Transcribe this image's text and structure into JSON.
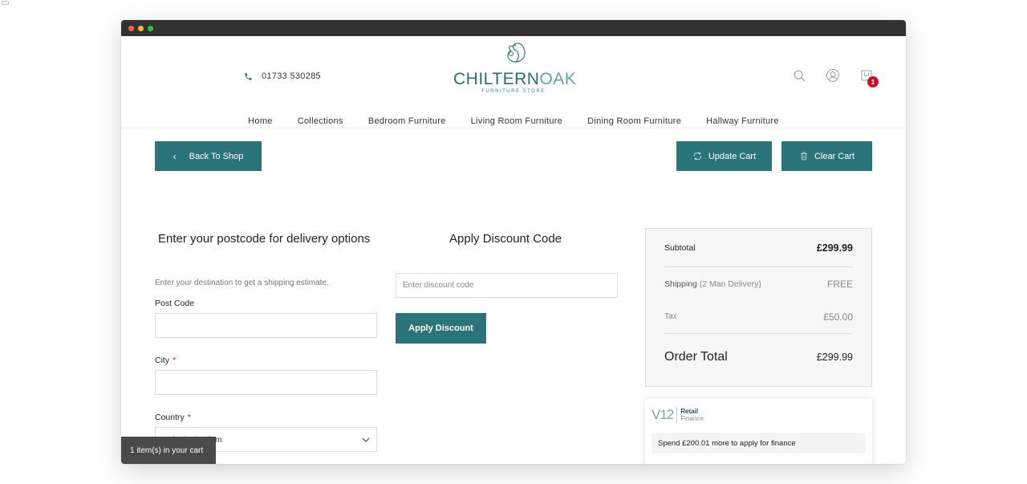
{
  "header": {
    "phone": "01733 530285",
    "logo_brand_main": "CHILTERN",
    "logo_brand_accent": "OAK",
    "logo_sub": "FURNITURE STORE",
    "cart_count": "1"
  },
  "nav": {
    "items": [
      {
        "label": "Home"
      },
      {
        "label": "Collections"
      },
      {
        "label": "Bedroom Furniture"
      },
      {
        "label": "Living Room Furniture"
      },
      {
        "label": "Dining Room Furniture"
      },
      {
        "label": "Hallway Furniture"
      }
    ]
  },
  "actions": {
    "back_label": "Back To Shop",
    "update_label": "Update Cart",
    "clear_label": "Clear Cart"
  },
  "delivery": {
    "title": "Enter your postcode for delivery options",
    "hint": "Enter your destination to get a shipping estimate.",
    "postcode_label": "Post Code",
    "postcode_value": "",
    "city_label": "City",
    "city_value": "",
    "country_label": "Country",
    "country_value": "United Kingdom",
    "required_mark": "*"
  },
  "discount": {
    "title": "Apply Discount Code",
    "placeholder": "Enter discount code",
    "apply_label": "Apply Discount"
  },
  "summary": {
    "subtotal_label": "Subtotal",
    "subtotal_value": "£299.99",
    "shipping_label": "Shipping",
    "shipping_method": "(2 Man Delivery)",
    "shipping_value": "FREE",
    "tax_label": "Tax",
    "tax_value": "£50.00",
    "total_label": "Order Total",
    "total_value": "£299.99"
  },
  "finance": {
    "logo_mark": "V12",
    "logo_line1": "Retail",
    "logo_line2": "Finance",
    "message": "Spend £200.01 more to apply for finance"
  },
  "toast": {
    "text": "1 item(s) in your cart"
  },
  "colors": {
    "brand": "#2b7479",
    "badge": "#c8102e"
  }
}
